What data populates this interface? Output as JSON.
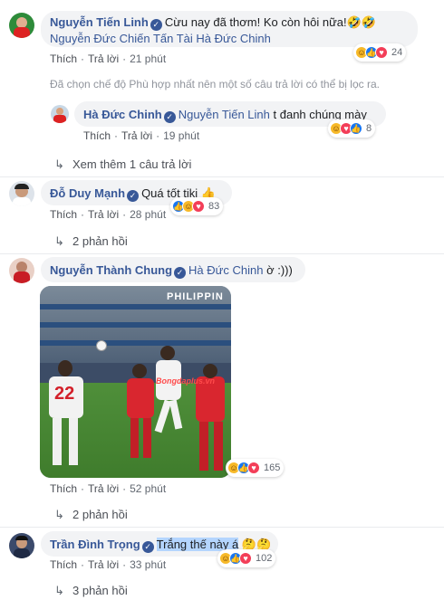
{
  "comments": [
    {
      "author": "Nguyễn Tiến Linh",
      "text_line1": "Cừu nay đã thơm! Ko còn hôi nữa!",
      "text_line1_emoji": "🤣🤣",
      "text_line2": "Nguyễn Đức Chiến Tấn Tài Hà Đức Chinh",
      "like_label": "Thích",
      "reply_label": "Trả lời",
      "time": "21 phút",
      "reaction_count": "24"
    }
  ],
  "filter_note": "Đã chọn chế độ Phù hợp nhất nên một số câu trả lời có thể bị lọc ra.",
  "reply": {
    "author": "Hà Đức Chinh",
    "tag": "Nguyễn Tiến Linh",
    "text": "t đanh chúng mày",
    "like_label": "Thích",
    "reply_label": "Trả lời",
    "time": "19 phút",
    "reaction_count": "8"
  },
  "more_replies_1": "Xem thêm 1 câu trả lời",
  "comment2": {
    "author": "Đỗ Duy Mạnh",
    "text": "Quá tốt tiki",
    "emoji": "👍",
    "like_label": "Thích",
    "reply_label": "Trả lời",
    "time": "28 phút",
    "reaction_count": "83",
    "replies": "2 phản hồi"
  },
  "comment3": {
    "author": "Nguyễn Thành Chung",
    "tag": "Hà Đức Chinh",
    "text": "ờ :)))",
    "photo_watermark": "Bongdaplus.vn",
    "photo_jersey": "22",
    "photo_banner": "PHILIPPIN",
    "like_label": "Thích",
    "reply_label": "Trả lời",
    "time": "52 phút",
    "reaction_count": "165",
    "replies": "2 phản hồi"
  },
  "comment4": {
    "author": "Trần Đình Trọng",
    "text": "Trắng thế này á",
    "emoji": "🤔🤔",
    "like_label": "Thích",
    "reply_label": "Trả lời",
    "time": "33 phút",
    "reaction_count": "102",
    "replies": "3 phản hồi"
  },
  "colors": {
    "link": "#385898",
    "bubble": "#f2f3f5",
    "highlight": "#b4d5fe"
  }
}
